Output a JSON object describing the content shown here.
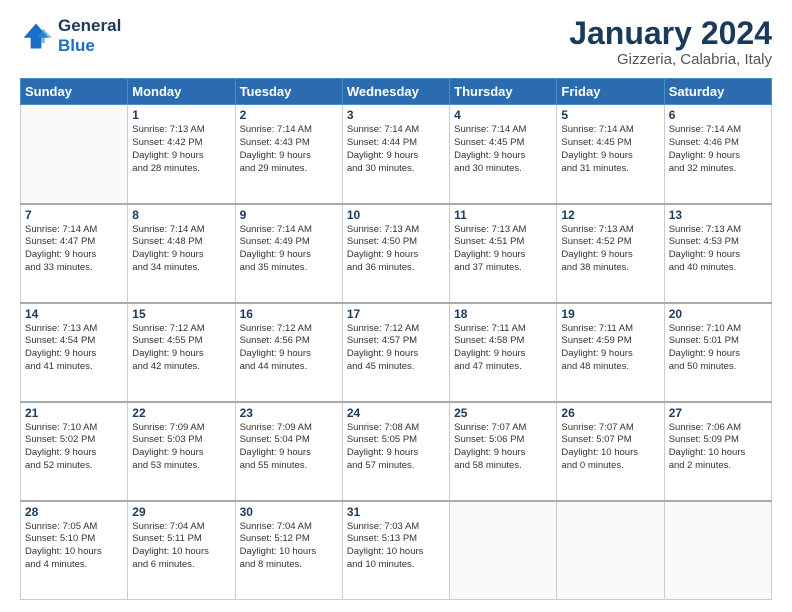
{
  "header": {
    "logo_line1": "General",
    "logo_line2": "Blue",
    "title": "January 2024",
    "subtitle": "Gizzeria, Calabria, Italy"
  },
  "columns": [
    "Sunday",
    "Monday",
    "Tuesday",
    "Wednesday",
    "Thursday",
    "Friday",
    "Saturday"
  ],
  "weeks": [
    [
      {
        "day": "",
        "info": ""
      },
      {
        "day": "1",
        "info": "Sunrise: 7:13 AM\nSunset: 4:42 PM\nDaylight: 9 hours\nand 28 minutes."
      },
      {
        "day": "2",
        "info": "Sunrise: 7:14 AM\nSunset: 4:43 PM\nDaylight: 9 hours\nand 29 minutes."
      },
      {
        "day": "3",
        "info": "Sunrise: 7:14 AM\nSunset: 4:44 PM\nDaylight: 9 hours\nand 30 minutes."
      },
      {
        "day": "4",
        "info": "Sunrise: 7:14 AM\nSunset: 4:45 PM\nDaylight: 9 hours\nand 30 minutes."
      },
      {
        "day": "5",
        "info": "Sunrise: 7:14 AM\nSunset: 4:45 PM\nDaylight: 9 hours\nand 31 minutes."
      },
      {
        "day": "6",
        "info": "Sunrise: 7:14 AM\nSunset: 4:46 PM\nDaylight: 9 hours\nand 32 minutes."
      }
    ],
    [
      {
        "day": "7",
        "info": "Sunrise: 7:14 AM\nSunset: 4:47 PM\nDaylight: 9 hours\nand 33 minutes."
      },
      {
        "day": "8",
        "info": "Sunrise: 7:14 AM\nSunset: 4:48 PM\nDaylight: 9 hours\nand 34 minutes."
      },
      {
        "day": "9",
        "info": "Sunrise: 7:14 AM\nSunset: 4:49 PM\nDaylight: 9 hours\nand 35 minutes."
      },
      {
        "day": "10",
        "info": "Sunrise: 7:13 AM\nSunset: 4:50 PM\nDaylight: 9 hours\nand 36 minutes."
      },
      {
        "day": "11",
        "info": "Sunrise: 7:13 AM\nSunset: 4:51 PM\nDaylight: 9 hours\nand 37 minutes."
      },
      {
        "day": "12",
        "info": "Sunrise: 7:13 AM\nSunset: 4:52 PM\nDaylight: 9 hours\nand 38 minutes."
      },
      {
        "day": "13",
        "info": "Sunrise: 7:13 AM\nSunset: 4:53 PM\nDaylight: 9 hours\nand 40 minutes."
      }
    ],
    [
      {
        "day": "14",
        "info": "Sunrise: 7:13 AM\nSunset: 4:54 PM\nDaylight: 9 hours\nand 41 minutes."
      },
      {
        "day": "15",
        "info": "Sunrise: 7:12 AM\nSunset: 4:55 PM\nDaylight: 9 hours\nand 42 minutes."
      },
      {
        "day": "16",
        "info": "Sunrise: 7:12 AM\nSunset: 4:56 PM\nDaylight: 9 hours\nand 44 minutes."
      },
      {
        "day": "17",
        "info": "Sunrise: 7:12 AM\nSunset: 4:57 PM\nDaylight: 9 hours\nand 45 minutes."
      },
      {
        "day": "18",
        "info": "Sunrise: 7:11 AM\nSunset: 4:58 PM\nDaylight: 9 hours\nand 47 minutes."
      },
      {
        "day": "19",
        "info": "Sunrise: 7:11 AM\nSunset: 4:59 PM\nDaylight: 9 hours\nand 48 minutes."
      },
      {
        "day": "20",
        "info": "Sunrise: 7:10 AM\nSunset: 5:01 PM\nDaylight: 9 hours\nand 50 minutes."
      }
    ],
    [
      {
        "day": "21",
        "info": "Sunrise: 7:10 AM\nSunset: 5:02 PM\nDaylight: 9 hours\nand 52 minutes."
      },
      {
        "day": "22",
        "info": "Sunrise: 7:09 AM\nSunset: 5:03 PM\nDaylight: 9 hours\nand 53 minutes."
      },
      {
        "day": "23",
        "info": "Sunrise: 7:09 AM\nSunset: 5:04 PM\nDaylight: 9 hours\nand 55 minutes."
      },
      {
        "day": "24",
        "info": "Sunrise: 7:08 AM\nSunset: 5:05 PM\nDaylight: 9 hours\nand 57 minutes."
      },
      {
        "day": "25",
        "info": "Sunrise: 7:07 AM\nSunset: 5:06 PM\nDaylight: 9 hours\nand 58 minutes."
      },
      {
        "day": "26",
        "info": "Sunrise: 7:07 AM\nSunset: 5:07 PM\nDaylight: 10 hours\nand 0 minutes."
      },
      {
        "day": "27",
        "info": "Sunrise: 7:06 AM\nSunset: 5:09 PM\nDaylight: 10 hours\nand 2 minutes."
      }
    ],
    [
      {
        "day": "28",
        "info": "Sunrise: 7:05 AM\nSunset: 5:10 PM\nDaylight: 10 hours\nand 4 minutes."
      },
      {
        "day": "29",
        "info": "Sunrise: 7:04 AM\nSunset: 5:11 PM\nDaylight: 10 hours\nand 6 minutes."
      },
      {
        "day": "30",
        "info": "Sunrise: 7:04 AM\nSunset: 5:12 PM\nDaylight: 10 hours\nand 8 minutes."
      },
      {
        "day": "31",
        "info": "Sunrise: 7:03 AM\nSunset: 5:13 PM\nDaylight: 10 hours\nand 10 minutes."
      },
      {
        "day": "",
        "info": ""
      },
      {
        "day": "",
        "info": ""
      },
      {
        "day": "",
        "info": ""
      }
    ]
  ]
}
